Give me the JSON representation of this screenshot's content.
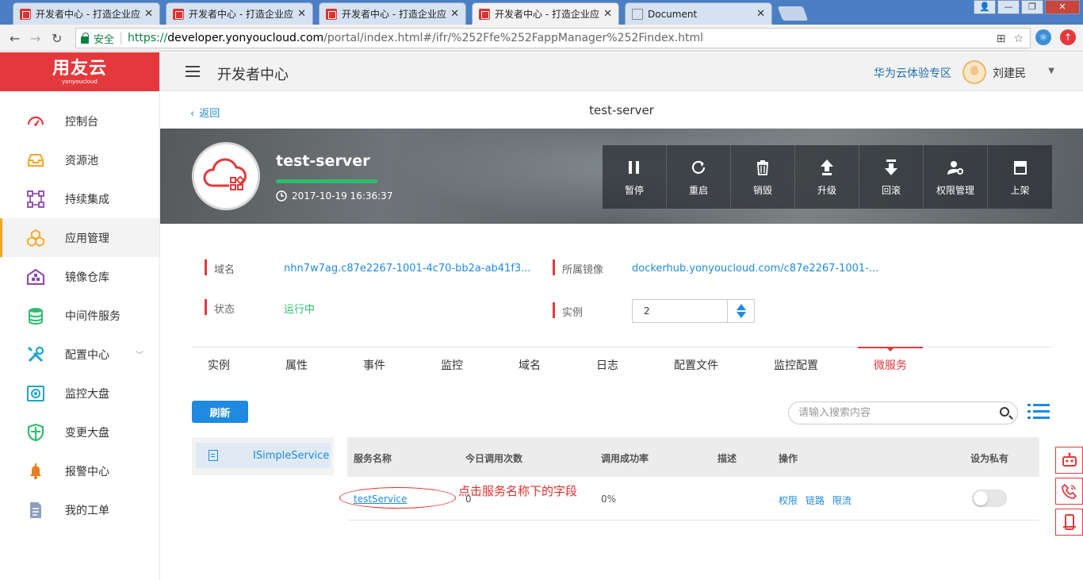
{
  "browser": {
    "tabs": [
      {
        "title": "开发者中心 - 打造企业应",
        "active": false
      },
      {
        "title": "开发者中心 - 打造企业应",
        "active": false
      },
      {
        "title": "开发者中心 - 打造企业应",
        "active": false
      },
      {
        "title": "开发者中心 - 打造企业应",
        "active": true
      },
      {
        "title": "Document",
        "active": false
      }
    ],
    "secure_label": "安全",
    "url_scheme": "https://",
    "url_host": "developer.yonyoucloud.com",
    "url_path": "/portal/index.html#/ifr/%252Ffe%252FappManager%252Findex.html"
  },
  "sidebar": {
    "logo_main": "用友云",
    "logo_sub": "yonyoucloud",
    "items": [
      {
        "label": "控制台",
        "icon": "dashboard-icon",
        "color": "#e4393c"
      },
      {
        "label": "资源池",
        "icon": "inbox-icon",
        "color": "#f5a623"
      },
      {
        "label": "持续集成",
        "icon": "integration-icon",
        "color": "#8e44ad"
      },
      {
        "label": "应用管理",
        "icon": "cubes-icon",
        "color": "#f5a623"
      },
      {
        "label": "镜像仓库",
        "icon": "warehouse-icon",
        "color": "#8e44ad"
      },
      {
        "label": "中间件服务",
        "icon": "database-icon",
        "color": "#2dbd6e"
      },
      {
        "label": "配置中心",
        "icon": "tools-icon",
        "color": "#1fa5c8"
      },
      {
        "label": "监控大盘",
        "icon": "monitor-icon",
        "color": "#1fa5c8"
      },
      {
        "label": "变更大盘",
        "icon": "shield-icon",
        "color": "#2dbd6e"
      },
      {
        "label": "报警中心",
        "icon": "bell-icon",
        "color": "#e67e22"
      },
      {
        "label": "我的工单",
        "icon": "document-icon",
        "color": "#8e9fc0"
      }
    ]
  },
  "header": {
    "title": "开发者中心",
    "zone_link": "华为云体验专区",
    "username": "刘建民"
  },
  "page": {
    "back": "返回",
    "title": "test-server"
  },
  "app": {
    "name": "test-server",
    "created": "2017-10-19 16:36:37",
    "actions": [
      {
        "label": "暂停",
        "icon": "pause-icon"
      },
      {
        "label": "重启",
        "icon": "restart-icon"
      },
      {
        "label": "销毁",
        "icon": "trash-icon"
      },
      {
        "label": "升级",
        "icon": "upgrade-icon"
      },
      {
        "label": "回滚",
        "icon": "rollback-icon"
      },
      {
        "label": "权限管理",
        "icon": "user-settings-icon"
      },
      {
        "label": "上架",
        "icon": "store-icon"
      }
    ]
  },
  "info": {
    "domain_label": "域名",
    "domain_value": "nhn7w7ag.c87e2267-1001-4c70-bb2a-ab41f3...",
    "image_label": "所属镜像",
    "image_value": "dockerhub.yonyoucloud.com/c87e2267-1001-...",
    "status_label": "状态",
    "status_value": "运行中",
    "instance_label": "实例",
    "instance_value": "2"
  },
  "tabs": [
    "实例",
    "属性",
    "事件",
    "监控",
    "域名",
    "日志",
    "配置文件",
    "监控配置",
    "微服务"
  ],
  "active_tab": "微服务",
  "toolbar": {
    "refresh": "刷新",
    "search_placeholder": "请输入搜索内容"
  },
  "services": [
    "ISimpleService"
  ],
  "table": {
    "columns": [
      "服务名称",
      "今日调用次数",
      "调用成功率",
      "描述",
      "操作",
      "设为私有"
    ],
    "rows": [
      {
        "name": "testService",
        "calls": "0",
        "success_rate": "0%",
        "description": "",
        "ops": [
          "权限",
          "链路",
          "限流"
        ],
        "private": false
      }
    ]
  },
  "annotation": "点击服务名称下的字段",
  "colors": {
    "brand": "#e4393c",
    "link": "#1f8ae0",
    "running": "#2dbd6e"
  }
}
